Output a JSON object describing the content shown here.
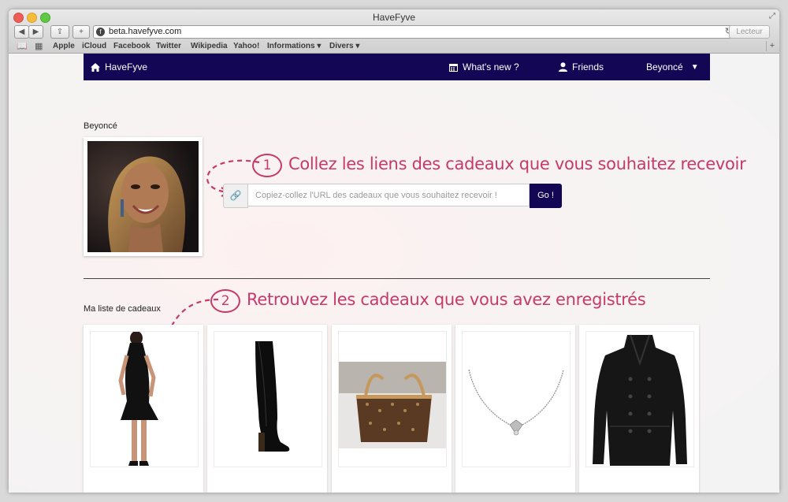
{
  "browser": {
    "window_title": "HaveFyve",
    "url": "beta.havefyve.com",
    "reader_label": "Lecteur",
    "bookmarks": [
      "Apple",
      "iCloud",
      "Facebook",
      "Twitter",
      "Wikipedia",
      "Yahoo!",
      "Informations ▾",
      "Divers ▾"
    ]
  },
  "nav": {
    "brand": "HaveFyve",
    "whats_new": "What's new ?",
    "friends": "Friends",
    "user": "Beyoncé"
  },
  "profile": {
    "name": "Beyoncé"
  },
  "annotations": {
    "step1_number": "1",
    "step1_text": "Collez les liens des cadeaux que vous souhaitez recevoir",
    "step2_number": "2",
    "step2_text": "Retrouvez les cadeaux que vous avez enregistrés"
  },
  "add_gift": {
    "placeholder": "Copiez-collez l'URL des cadeaux que vous souhaitez recevoir !",
    "button": "Go !"
  },
  "gift_list": {
    "title": "Ma liste de cadeaux",
    "items": [
      {
        "name": "black-dress"
      },
      {
        "name": "black-boots"
      },
      {
        "name": "monogram-bag"
      },
      {
        "name": "diamond-necklace"
      },
      {
        "name": "black-jacket"
      }
    ]
  },
  "colors": {
    "nav_bg": "#120655",
    "accent": "#c63a6b"
  }
}
